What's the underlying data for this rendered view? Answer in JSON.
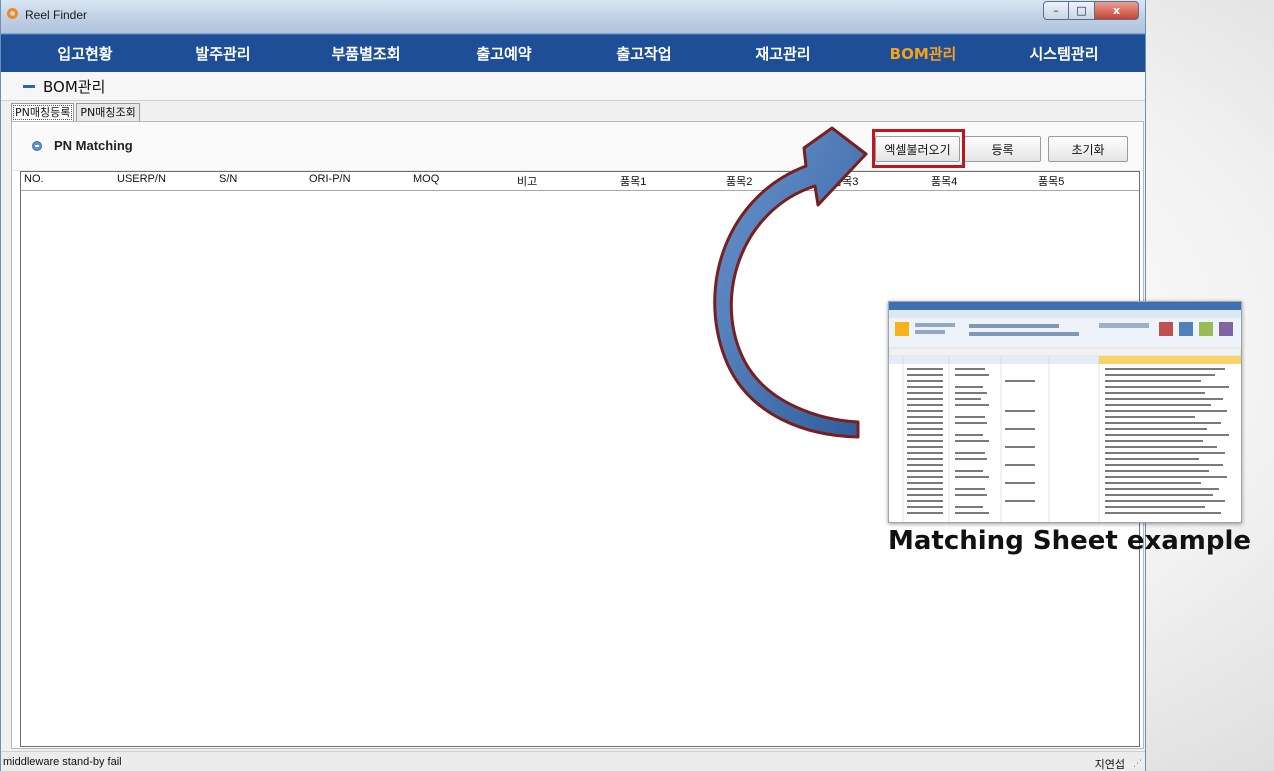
{
  "window": {
    "title": "Reel Finder",
    "controls": {
      "minimize": "–",
      "maximize": "□",
      "close": "x"
    }
  },
  "menu": {
    "items": [
      "입고현황",
      "발주관리",
      "부품별조회",
      "출고예약",
      "출고작업",
      "재고관리",
      "BOM관리",
      "시스템관리"
    ],
    "active_index": 6
  },
  "section": {
    "title": "BOM관리"
  },
  "tabs": [
    "PN매칭등록",
    "PN매칭조회"
  ],
  "panel": {
    "title": "PN Matching",
    "buttons": {
      "excel": "엑셀불러오기",
      "register": "등록",
      "reset": "초기화"
    }
  },
  "grid": {
    "columns": [
      "NO.",
      "USERP/N",
      "S/N",
      "ORI-P/N",
      "MOQ",
      "비고",
      "품목1",
      "품목2",
      "품목3",
      "품목4",
      "품목5"
    ]
  },
  "status": {
    "left": "middleware stand-by fail",
    "right": "지연섭"
  },
  "annotation": {
    "caption": "Matching Sheet example",
    "highlight_color": "#c0161b",
    "arrow_color": "#3f6fb0"
  },
  "colors": {
    "menubar": "#1d4e96",
    "menu_active": "#f6a21c"
  }
}
